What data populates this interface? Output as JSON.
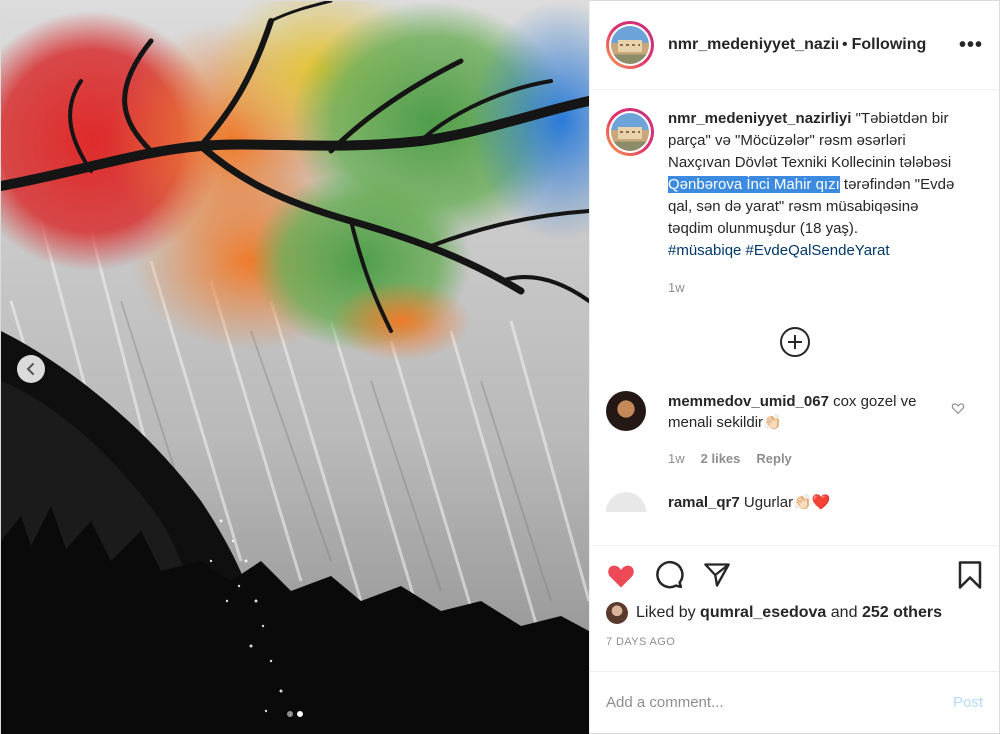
{
  "post": {
    "username": "nmr_medeniyyet_nazirl",
    "follow_state": "Following",
    "more_icon": "more-horizontal-icon"
  },
  "caption": {
    "author": "nmr_medeniyyet_nazirliyi",
    "text_before": "\"Təbiətdən bir parça\" və \"Möcüzələr\" rəsm əsərləri Naxçıvan Dövlət Texniki Kollecinin tələbəsi ",
    "highlight": "Qənbərova İnci Mahir qızı",
    "text_after": " tərəfindən \"Evdə qal, sən də yarat\" rəsm müsabiqəsinə təqdim olunmuşdur (18 yaş).",
    "hashtags": "#müsabiqe #EvdeQalSendeYarat",
    "time": "1w"
  },
  "comments": [
    {
      "author": "memmedov_umid_067",
      "text": "cox gozel ve menali sekildir👏🏻",
      "time": "1w",
      "likes": "2 likes",
      "reply": "Reply"
    },
    {
      "author": "ramal_qr7",
      "text": "Ugurlar👏🏻❤️"
    }
  ],
  "actions": {
    "liked_by_prefix": "Liked by ",
    "liked_by_user": "qumral_esedova",
    "liked_by_middle": " and ",
    "liked_by_count": "252 others",
    "date": "7 DAYS AGO"
  },
  "composer": {
    "placeholder": "Add a comment...",
    "post_label": "Post"
  },
  "colors": {
    "like_red": "#ed4956",
    "highlight_blue": "#3c8be0",
    "hashtag": "#00376b"
  },
  "carousel": {
    "slides": 2,
    "active": 2
  }
}
